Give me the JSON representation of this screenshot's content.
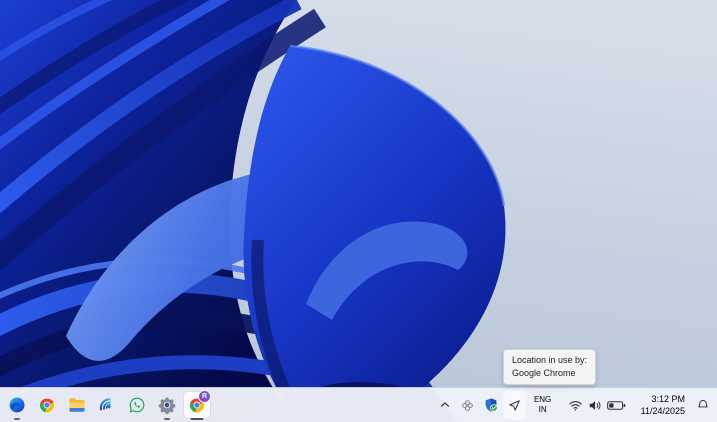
{
  "desktop": {
    "wallpaper_name": "windows-11-blue-bloom"
  },
  "tooltip": {
    "line1": "Location in use by:",
    "line2": "Google Chrome"
  },
  "taskbar": {
    "apps": [
      {
        "icon": "edge-icon",
        "name": "Microsoft Edge",
        "running": true,
        "active": false,
        "badge": ""
      },
      {
        "icon": "chrome-icon",
        "name": "Google Chrome",
        "running": false,
        "active": false,
        "badge": ""
      },
      {
        "icon": "file-explorer-icon",
        "name": "File Explorer",
        "running": false,
        "active": false,
        "badge": ""
      },
      {
        "icon": "spiral-wave-app-icon",
        "name": "Wave spiral app",
        "running": false,
        "active": false,
        "badge": ""
      },
      {
        "icon": "whatsapp-icon",
        "name": "WhatsApp",
        "running": false,
        "active": false,
        "badge": ""
      },
      {
        "icon": "settings-gear-icon",
        "name": "Settings",
        "running": true,
        "active": false,
        "badge": ""
      },
      {
        "icon": "chrome-profile-icon",
        "name": "Google Chrome profile",
        "running": true,
        "active": true,
        "badge": "R"
      }
    ],
    "tray": {
      "language": {
        "line1": "ENG",
        "line2": "IN"
      },
      "clock": {
        "time": "3:12 PM",
        "date": "11/24/2025"
      },
      "icons": [
        "chevron-up-icon",
        "flower-app-icon",
        "security-shield-check-icon",
        "location-in-use-icon",
        "wifi-icon",
        "volume-icon",
        "battery-icon",
        "notification-bell-icon"
      ]
    }
  },
  "colors": {
    "taskbar_bg": "#edf1f8",
    "tooltip_bg": "#f2f4f6",
    "bloom_bright": "#2b55ea",
    "bloom_dark": "#071463",
    "desktop_light": "#c6d1df",
    "badge_purple": "#7a52cf",
    "whatsapp_green": "#1fa855",
    "security_green": "#2aa63c"
  }
}
